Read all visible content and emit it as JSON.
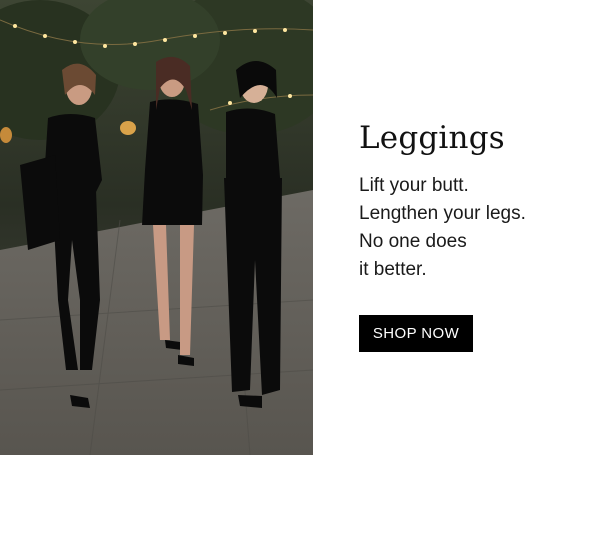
{
  "promo": {
    "title": "Leggings",
    "body_lines": [
      "Lift your butt.",
      "Lengthen your legs.",
      "No one does",
      "it better."
    ],
    "cta_label": "SHOP NOW"
  },
  "colors": {
    "cta_background": "#000000",
    "cta_text": "#ffffff",
    "heading": "#111111"
  }
}
